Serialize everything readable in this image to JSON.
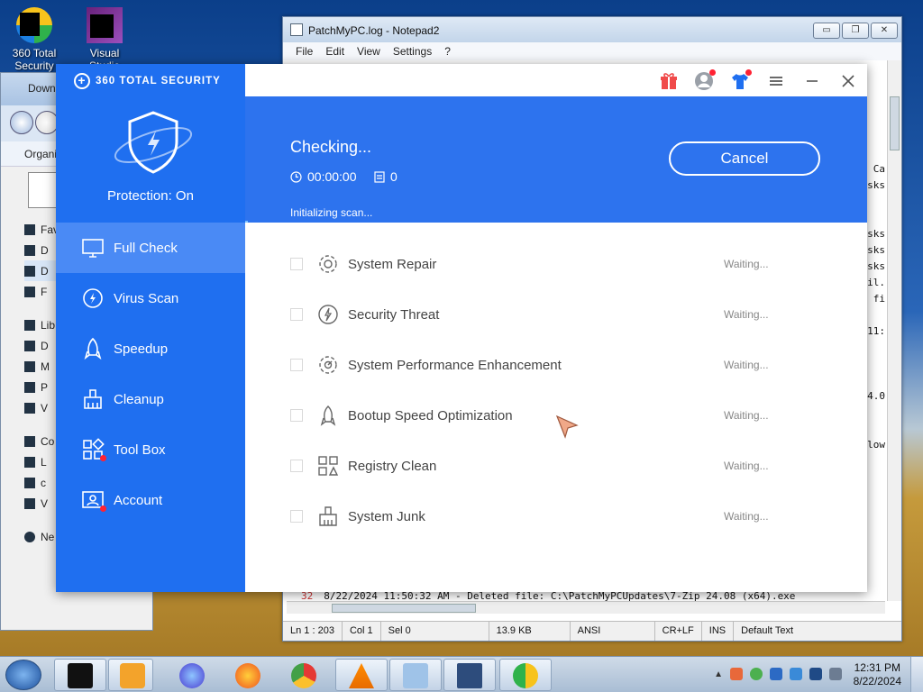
{
  "desktop": {
    "icons": [
      {
        "label": "360 Total Security"
      },
      {
        "label": "Visual Studio"
      }
    ]
  },
  "explorer": {
    "title": "Down",
    "organize": "Organi",
    "tree": [
      "Fav",
      "D",
      "D",
      "F",
      "Lib",
      "D",
      "M",
      "P",
      "V",
      "Co",
      "L",
      "c",
      "V",
      "Ne"
    ]
  },
  "notepad": {
    "title": "PatchMyPC.log - Notepad2",
    "menu": [
      "File",
      "Edit",
      "View",
      "Settings",
      "?"
    ],
    "right_fragments": [
      "y Ca",
      "sks",
      "sks",
      "sks",
      "sks",
      "til.",
      "l fi",
      "11:",
      "24.0",
      "low"
    ],
    "last_line_no": "32",
    "last_line": "8/22/2024 11:50:32 AM - Deleted file: C:\\PatchMyPCUpdates\\7-Zip 24.08 (x64).exe",
    "status": [
      "Ln 1 : 203",
      "Col 1",
      "Sel 0",
      "13.9 KB",
      "ANSI",
      "CR+LF",
      "INS",
      "Default Text"
    ],
    "controls": {
      "minimize": "▭",
      "restore": "❐",
      "close": "✕"
    }
  },
  "app": {
    "brand": "360 TOTAL SECURITY",
    "protection": "Protection: On",
    "menu": [
      {
        "label": "Full Check",
        "active": true
      },
      {
        "label": "Virus Scan",
        "active": false
      },
      {
        "label": "Speedup",
        "active": false
      },
      {
        "label": "Cleanup",
        "active": false
      },
      {
        "label": "Tool Box",
        "active": false
      },
      {
        "label": "Account",
        "active": false
      }
    ],
    "header": {
      "checking": "Checking...",
      "timer": "00:00:00",
      "count": "0",
      "status": "Initializing scan...",
      "cancel": "Cancel",
      "progress": 0.005
    },
    "items": [
      {
        "label": "System Repair",
        "status": "Waiting...",
        "icon": "gear-wrench-icon"
      },
      {
        "label": "Security Threat",
        "status": "Waiting...",
        "icon": "bolt-circle-icon"
      },
      {
        "label": "System Performance Enhancement",
        "status": "Waiting...",
        "icon": "gear-speed-icon"
      },
      {
        "label": "Bootup Speed Optimization",
        "status": "Waiting...",
        "icon": "rocket-icon"
      },
      {
        "label": "Registry Clean",
        "status": "Waiting...",
        "icon": "registry-icon"
      },
      {
        "label": "System Junk",
        "status": "Waiting...",
        "icon": "broom-icon"
      }
    ],
    "colors": {
      "primary": "#1f6ff0",
      "header": "#2d73ee",
      "active_menu": "#4a8af5",
      "badge": "#ff2233"
    }
  },
  "taskbar": {
    "clock_time": "12:31 PM",
    "clock_date": "8/22/2024"
  }
}
